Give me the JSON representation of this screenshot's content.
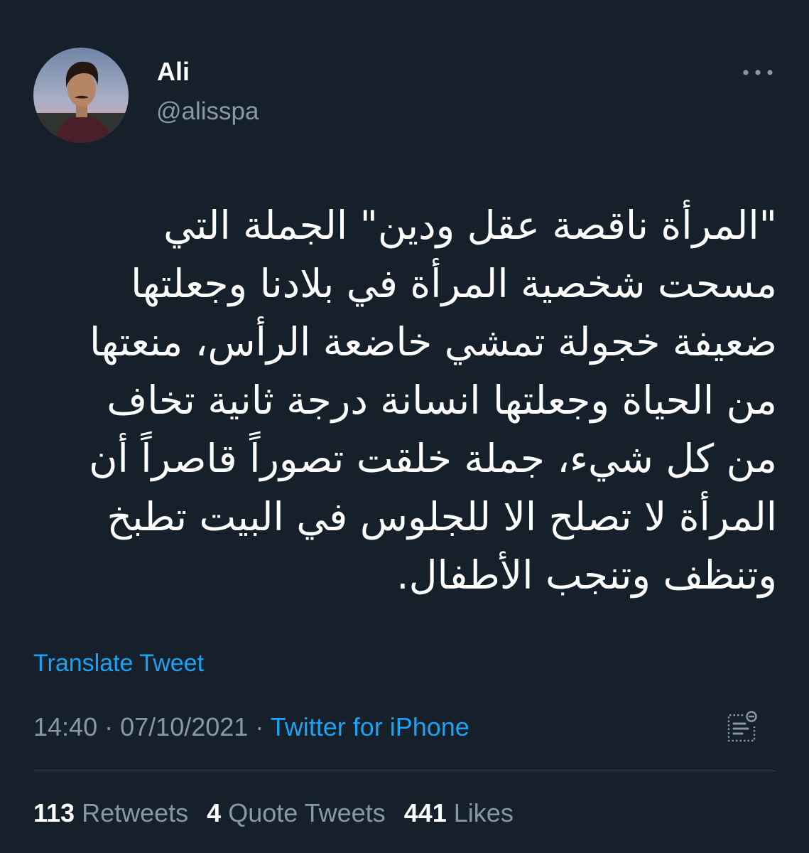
{
  "user": {
    "name": "Ali",
    "handle": "@alisspa"
  },
  "tweet": {
    "lines": [
      "\"المرأة ناقصة عقل ودين\" الجملة التي",
      "مسحت شخصية المرأة في بلادنا وجعلتها",
      "ضعيفة خجولة تمشي خاضعة الرأس، منعتها",
      "من الحياة وجعلتها انسانة درجة ثانية تخاف",
      "من كل شيء، جملة خلقت تصوراً قاصراً أن",
      "المرأة لا تصلح الا للجلوس في البيت تطبخ",
      "وتنظف وتنجب الأطفال."
    ],
    "translate_label": "Translate Tweet",
    "time": "14:40",
    "date": "07/10/2021",
    "separator": "·",
    "source": "Twitter for iPhone"
  },
  "stats": {
    "retweets_count": "113",
    "retweets_label": "Retweets",
    "quotes_count": "4",
    "quotes_label": "Quote Tweets",
    "likes_count": "441",
    "likes_label": "Likes"
  },
  "icons": {
    "more": "more-dots-icon",
    "analytics": "view-analytics-icon"
  },
  "colors": {
    "background": "#15202b",
    "text": "#ffffff",
    "secondary": "#8899a6",
    "accent": "#1da1f2",
    "divider": "#38444d"
  }
}
